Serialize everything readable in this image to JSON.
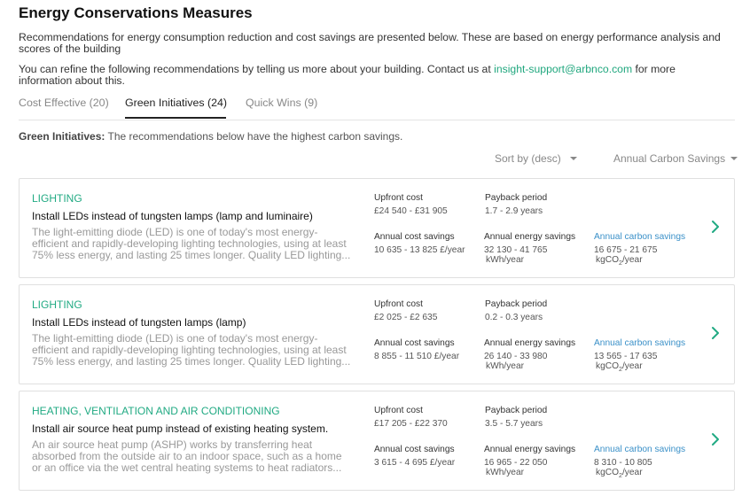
{
  "page": {
    "title": "Energy Conservations Measures",
    "intro1": "Recommendations for energy consumption reduction and cost savings are presented below. These are based on energy performance analysis and scores of the building",
    "intro2_pre": "You can refine the following recommendations by telling us more about your building. Contact us at ",
    "intro2_link": "insight-support@arbnco.com",
    "intro2_post": " for more information about this."
  },
  "tabs": [
    {
      "label": "Cost Effective (20)",
      "active": false
    },
    {
      "label": "Green Initiatives (24)",
      "active": true
    },
    {
      "label": "Quick Wins (9)",
      "active": false
    }
  ],
  "note": {
    "bold": "Green Initiatives:",
    "text": " The recommendations below have the highest carbon savings."
  },
  "sort": {
    "order": "Sort by (desc)",
    "field": "Annual Carbon Savings"
  },
  "labels": {
    "upfront": "Upfront cost",
    "payback": "Payback period",
    "cost_savings": "Annual cost savings",
    "energy_savings": "Annual energy savings",
    "carbon_savings": "Annual carbon savings",
    "carbon_unit_pre": "kgCO",
    "carbon_unit_sub": "2",
    "carbon_unit_post": "/year"
  },
  "measures": [
    {
      "category": "LIGHTING",
      "title": "Install LEDs instead of tungsten lamps (lamp and luminaire)",
      "description": "The light-emitting diode (LED) is one of today's most energy-efficient and rapidly-developing lighting technologies, using at least 75% less energy, and lasting 25 times longer. Quality LED lighting...",
      "upfront": "£24 540 - £31 905",
      "payback": "1.7 - 2.9  years",
      "cost_savings": "10 635 - 13 825  £/year",
      "energy_savings": "32 130 - 41 765",
      "energy_unit": "kWh/year",
      "carbon_savings": "16 675 - 21 675"
    },
    {
      "category": "LIGHTING",
      "title": "Install LEDs instead of tungsten lamps (lamp)",
      "description": "The light-emitting diode (LED) is one of today's most energy-efficient and rapidly-developing lighting technologies, using at least 75% less energy, and lasting 25 times longer. Quality LED lighting...",
      "upfront": "£2 025 - £2 635",
      "payback": "0.2 - 0.3  years",
      "cost_savings": "8 855 - 11 510  £/year",
      "energy_savings": "26 140 - 33 980",
      "energy_unit": "kWh/year",
      "carbon_savings": "13 565 - 17 635"
    },
    {
      "category": "HEATING, VENTILATION AND AIR CONDITIONING",
      "title": "Install air source heat pump instead of existing heating system.",
      "description": "An air source heat pump (ASHP) works by transferring heat absorbed from the outside air to an indoor space, such as a home or an office via the wet central heating systems to heat radiators...",
      "upfront": "£17 205 - £22 370",
      "payback": "3.5 - 5.7  years",
      "cost_savings": "3 615 - 4 695  £/year",
      "energy_savings": "16 965 - 22 050",
      "energy_unit": "kWh/year",
      "carbon_savings": "8 310 - 10 805"
    }
  ],
  "icons": {
    "chevron": "chevron-right-icon",
    "caret": "caret-down-icon"
  },
  "colors": {
    "accent_green": "#21aa83",
    "link_blue": "#3a90c8"
  }
}
